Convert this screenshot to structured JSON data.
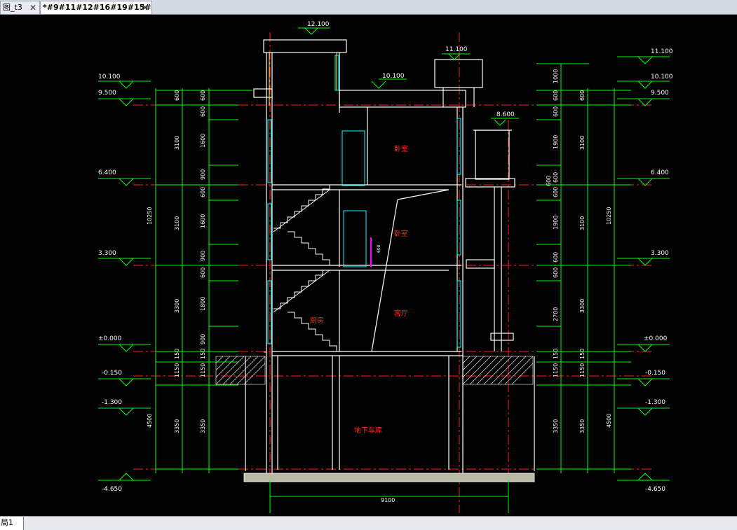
{
  "tabs": [
    {
      "label": "图_t3",
      "close": "✕"
    },
    {
      "label": "*#9#11#12#16#19#15#",
      "close": "✕"
    }
  ],
  "layout_tab": "局1",
  "drawing": {
    "elevations": {
      "top": "12.100",
      "right_top": "11.100",
      "mid_roof": "10.100",
      "balcony": "8.600",
      "l1": "10.100",
      "l2": "9.500",
      "l3": "6.400",
      "l4": "3.300",
      "l5": "±0.000",
      "l6": "-0.150",
      "l7": "-1.300",
      "l8": "-4.650",
      "r1": "11.100",
      "r2": "10.100",
      "r3": "9.500",
      "r4": "6.400",
      "r5": "3.300",
      "r6": "±0.000",
      "r7": "-0.150",
      "r8": "-1.300",
      "r9": "-4.650"
    },
    "left_dims_outer": [
      "10250",
      "4500"
    ],
    "left_dims_mid": [
      "600",
      "3100",
      "3100",
      "3300",
      "150",
      "1150",
      "3350"
    ],
    "left_dims_inner": [
      "600",
      "600",
      "1600",
      "900",
      "600",
      "1600",
      "900",
      "600",
      "1800",
      "900",
      "150",
      "1150",
      "3350"
    ],
    "right_dims_a": [
      "1000",
      "600",
      "600",
      "1900",
      "600",
      "600",
      "1900",
      "600",
      "600",
      "2700",
      "150",
      "1150",
      "3350"
    ],
    "right_dims_b": [
      "600",
      "3100",
      "3100",
      "3300",
      "150",
      "1150",
      "3350"
    ],
    "right_dims_outer": [
      "10250",
      "4500"
    ],
    "note_600": "600",
    "bottom_dim": "9100",
    "rooms": [
      "卧室",
      "卧室",
      "客厅",
      "厨房",
      "地下车库"
    ],
    "small_dim": "600"
  },
  "colors": {
    "bg": "#000000",
    "white": "#ffffff",
    "green": "#00ff00",
    "red": "#ff2020",
    "cyan": "#00ffff",
    "yellow": "#ffff00",
    "magenta": "#ff00ff"
  }
}
